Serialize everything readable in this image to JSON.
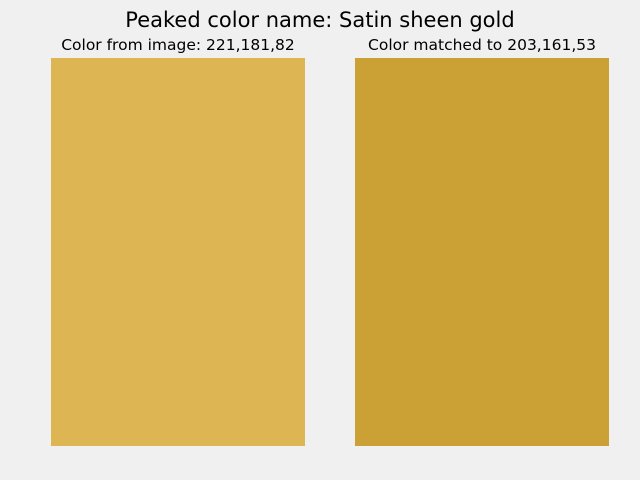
{
  "window": {
    "title": "Peaked color name: Satin sheen gold"
  },
  "panels": [
    {
      "title": "Color from image: 221,181,82",
      "color": "#ddb552"
    },
    {
      "title": "Color matched to 203,161,53",
      "color": "#cba135"
    }
  ],
  "colors": {
    "background": "#f0f0f0"
  }
}
